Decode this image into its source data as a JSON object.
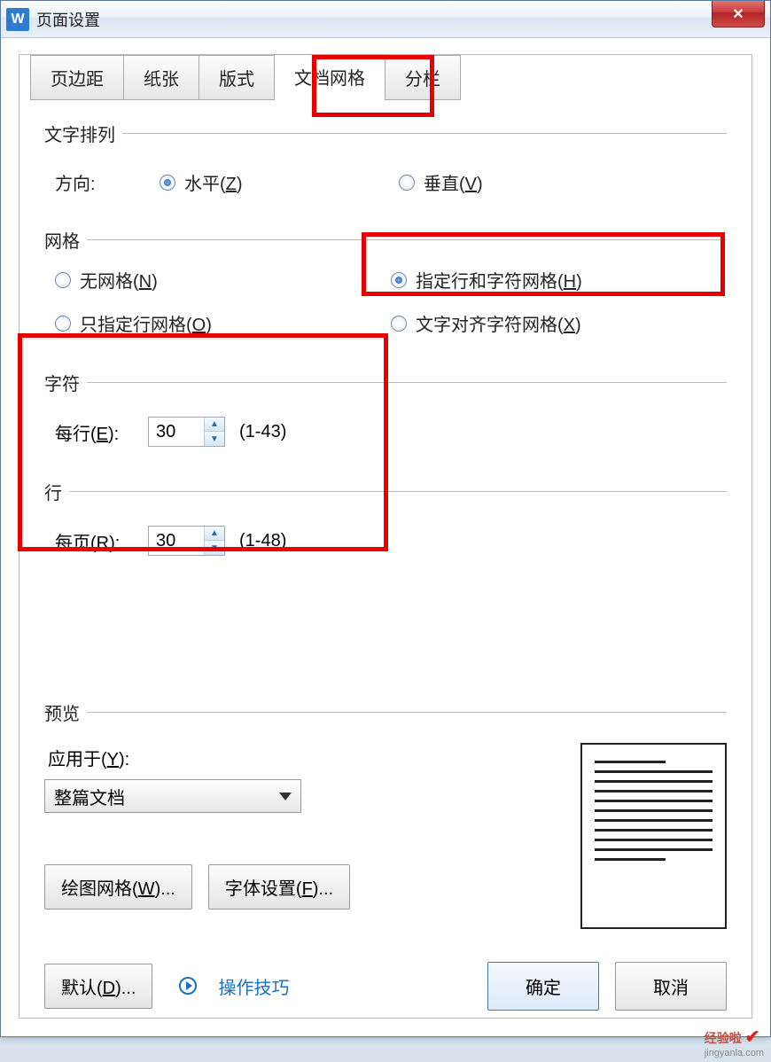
{
  "window": {
    "title": "页面设置"
  },
  "tabs": {
    "margins": "页边距",
    "paper": "纸张",
    "layout": "版式",
    "grid": "文档网格",
    "columns": "分栏",
    "active": "grid"
  },
  "text_direction": {
    "legend": "文字排列",
    "label": "方向:",
    "horizontal": "水平(Z)",
    "vertical": "垂直(V)"
  },
  "grid_group": {
    "legend": "网格",
    "none": "无网格(N)",
    "specify_line_char": "指定行和字符网格(H)",
    "lines_only": "只指定行网格(O)",
    "align_char": "文字对齐字符网格(X)"
  },
  "chars": {
    "legend": "字符",
    "per_line_label": "每行(E):",
    "per_line_value": "30",
    "per_line_range": "(1-43)"
  },
  "lines": {
    "legend": "行",
    "per_page_label": "每页(R):",
    "per_page_value": "30",
    "per_page_range": "(1-48)"
  },
  "preview": {
    "legend": "预览",
    "apply_label": "应用于(Y):",
    "apply_value": "整篇文档"
  },
  "buttons": {
    "draw_grid": "绘图网格(W)...",
    "font_settings": "字体设置(F)...",
    "default": "默认(D)...",
    "tips": "操作技巧",
    "ok": "确定",
    "cancel": "取消"
  },
  "watermark": {
    "brand": "经验啦",
    "url": "jingyanla.com"
  }
}
